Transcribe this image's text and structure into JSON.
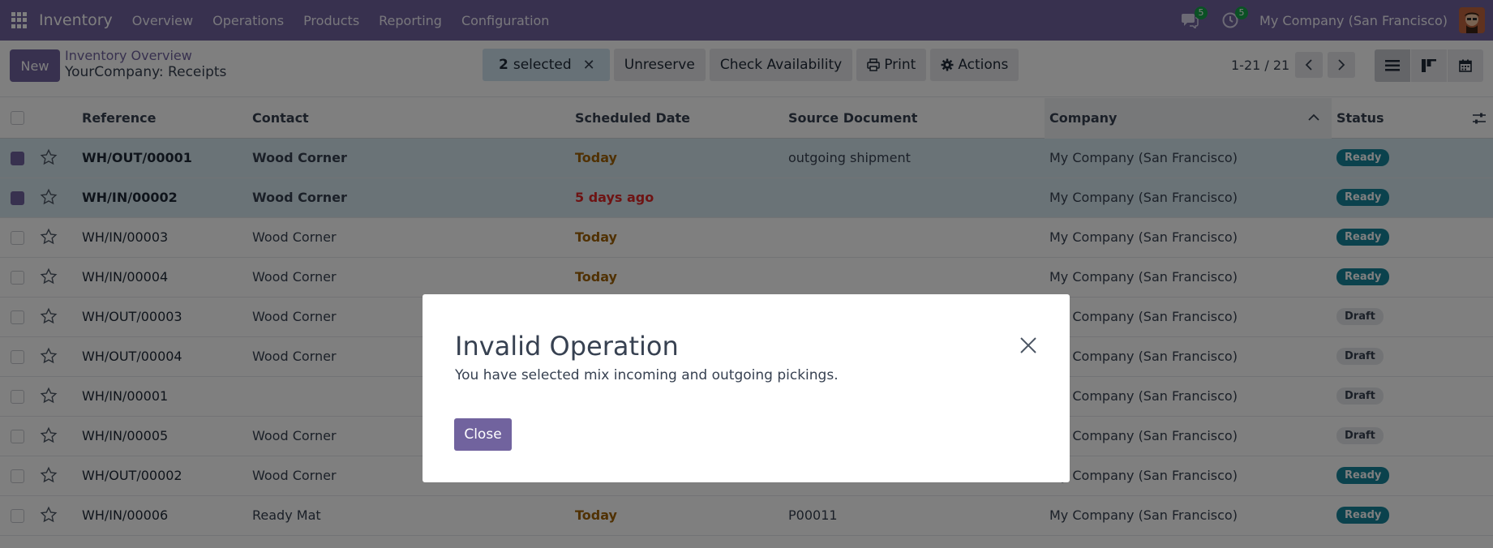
{
  "navbar": {
    "app_name": "Inventory",
    "menu": [
      "Overview",
      "Operations",
      "Products",
      "Reporting",
      "Configuration"
    ],
    "messages_count": "5",
    "activities_count": "5",
    "company": "My Company (San Francisco)"
  },
  "control_panel": {
    "new_label": "New",
    "breadcrumb_parent": "Inventory Overview",
    "breadcrumb_current": "YourCompany: Receipts",
    "selected_count": "2",
    "selected_label": "selected",
    "unreserve_label": "Unreserve",
    "check_availability_label": "Check Availability",
    "print_label": "Print",
    "actions_label": "Actions",
    "pager": "1-21 / 21"
  },
  "table": {
    "headers": {
      "reference": "Reference",
      "contact": "Contact",
      "scheduled_date": "Scheduled Date",
      "source_document": "Source Document",
      "company": "Company",
      "status": "Status"
    },
    "rows": [
      {
        "reference": "WH/OUT/00001",
        "contact": "Wood Corner",
        "date": "Today",
        "source": "outgoing shipment",
        "company": "My Company (San Francisco)",
        "status": "Ready"
      },
      {
        "reference": "WH/IN/00002",
        "contact": "Wood Corner",
        "date": "5 days ago",
        "source": "",
        "company": "My Company (San Francisco)",
        "status": "Ready"
      },
      {
        "reference": "WH/IN/00003",
        "contact": "Wood Corner",
        "date": "Today",
        "source": "",
        "company": "My Company (San Francisco)",
        "status": "Ready"
      },
      {
        "reference": "WH/IN/00004",
        "contact": "Wood Corner",
        "date": "Today",
        "source": "",
        "company": "My Company (San Francisco)",
        "status": "Ready"
      },
      {
        "reference": "WH/OUT/00003",
        "contact": "Wood Corner",
        "date": "",
        "source": "",
        "company": "My Company (San Francisco)",
        "status": "Draft"
      },
      {
        "reference": "WH/OUT/00004",
        "contact": "Wood Corner",
        "date": "",
        "source": "",
        "company": "My Company (San Francisco)",
        "status": "Draft"
      },
      {
        "reference": "WH/IN/00001",
        "contact": "",
        "date": "",
        "source": "",
        "company": "My Company (San Francisco)",
        "status": "Draft"
      },
      {
        "reference": "WH/IN/00005",
        "contact": "Wood Corner",
        "date": "",
        "source": "",
        "company": "My Company (San Francisco)",
        "status": "Draft"
      },
      {
        "reference": "WH/OUT/00002",
        "contact": "Wood Corner",
        "date": "",
        "source": "",
        "company": "My Company (San Francisco)",
        "status": "Ready"
      },
      {
        "reference": "WH/IN/00006",
        "contact": "Ready Mat",
        "date": "Today",
        "source": "P00011",
        "company": "My Company (San Francisco)",
        "status": "Ready"
      }
    ]
  },
  "modal": {
    "title": "Invalid Operation",
    "body": "You have selected mix incoming and outgoing pickings.",
    "close_label": "Close"
  }
}
